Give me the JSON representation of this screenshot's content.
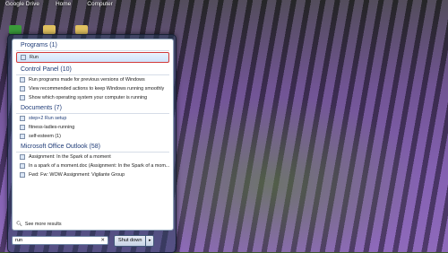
{
  "desktop": {
    "labels": [
      "Google Drive",
      "Home",
      "Computer"
    ]
  },
  "start_menu": {
    "sections": [
      {
        "header": "Programs (1)",
        "items": [
          "Run"
        ]
      },
      {
        "header": "Control Panel (10)",
        "items": [
          "Run programs made for previous versions of Windows",
          "View recommended actions to keep Windows running smoothly",
          "Show which operating system your computer is running"
        ]
      },
      {
        "header": "Documents (7)",
        "items": [
          "step+2 Run setup",
          "fitness-ladies-running",
          "self-esteem (1)"
        ]
      },
      {
        "header": "Microsoft Office Outlook (58)",
        "items": [
          "Assignment: In the Spark of a moment",
          "In a spark of a moment.doc (Assignment: In the Spark of a mom...",
          "Fwd: Fw: WOW Assignment: Vigilante Group"
        ]
      }
    ],
    "see_more": "See more results",
    "search_value": "run",
    "shutdown_label": "Shut down"
  }
}
